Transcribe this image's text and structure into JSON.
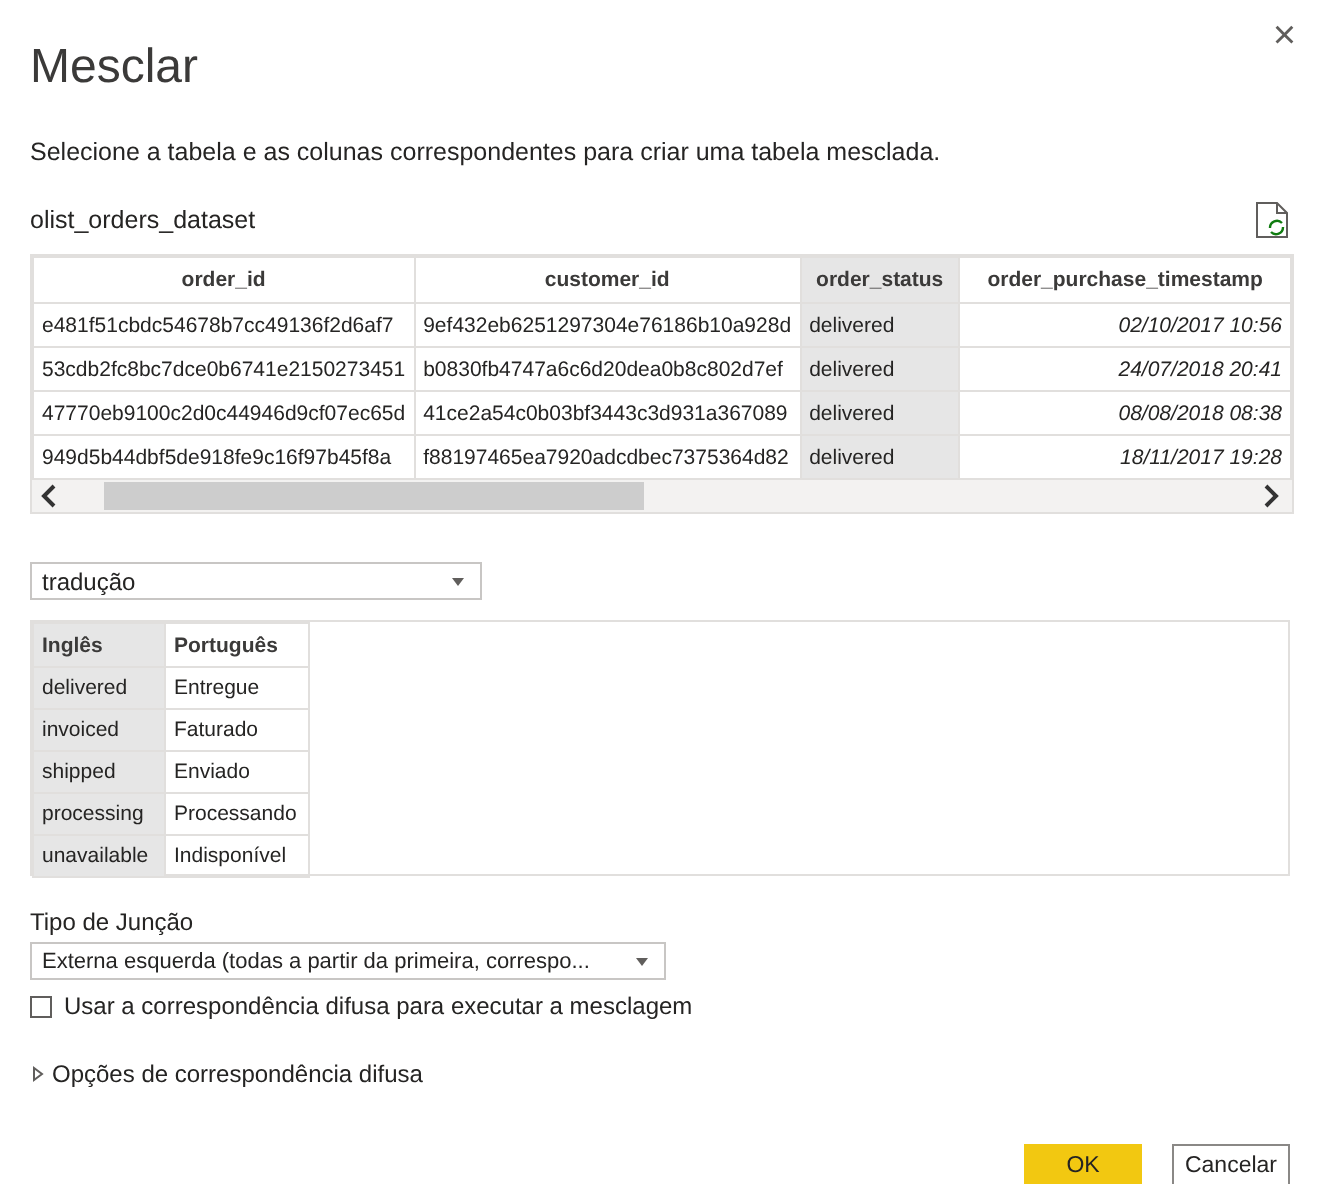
{
  "dialog": {
    "title": "Mesclar",
    "close": "×",
    "description": "Selecione a tabela e as colunas correspondentes para criar uma tabela mesclada."
  },
  "first_table": {
    "name": "olist_orders_dataset",
    "columns": [
      {
        "label": "order_id",
        "selected": false,
        "kind": "text"
      },
      {
        "label": "customer_id",
        "selected": false,
        "kind": "text"
      },
      {
        "label": "order_status",
        "selected": true,
        "kind": "text"
      },
      {
        "label": "order_purchase_timestamp",
        "selected": false,
        "kind": "date"
      }
    ],
    "rows": [
      [
        "e481f51cbdc54678b7cc49136f2d6af7",
        "9ef432eb6251297304e76186b10a928d",
        "delivered",
        "02/10/2017 10:56"
      ],
      [
        "53cdb2fc8bc7dce0b6741e2150273451",
        "b0830fb4747a6c6d20dea0b8c802d7ef",
        "delivered",
        "24/07/2018 20:41"
      ],
      [
        "47770eb9100c2d0c44946d9cf07ec65d",
        "41ce2a54c0b03bf3443c3d931a367089",
        "delivered",
        "08/08/2018 08:38"
      ],
      [
        "949d5b44dbf5de918fe9c16f97b45f8a",
        "f88197465ea7920adcdbec7375364d82",
        "delivered",
        "18/11/2017 19:28"
      ]
    ]
  },
  "second_table": {
    "select": {
      "value": "tradução"
    },
    "columns": [
      {
        "label": "Inglês",
        "selected": true
      },
      {
        "label": "Português",
        "selected": false
      }
    ],
    "rows": [
      [
        "delivered",
        "Entregue"
      ],
      [
        "invoiced",
        "Faturado"
      ],
      [
        "shipped",
        "Enviado"
      ],
      [
        "processing",
        "Processando"
      ],
      [
        "unavailable",
        "Indisponível"
      ]
    ]
  },
  "join": {
    "label": "Tipo de Junção",
    "value": "Externa esquerda (todas a partir da primeira, correspo..."
  },
  "fuzzy_checkbox": {
    "label": "Usar a correspondência difusa para executar a mesclagem",
    "checked": false
  },
  "fuzzy_options": {
    "label": "Opções de correspondência difusa",
    "expanded": false
  },
  "buttons": [
    {
      "label": "OK",
      "kind": "primary"
    },
    {
      "label": "Cancelar",
      "kind": "secondary"
    }
  ]
}
